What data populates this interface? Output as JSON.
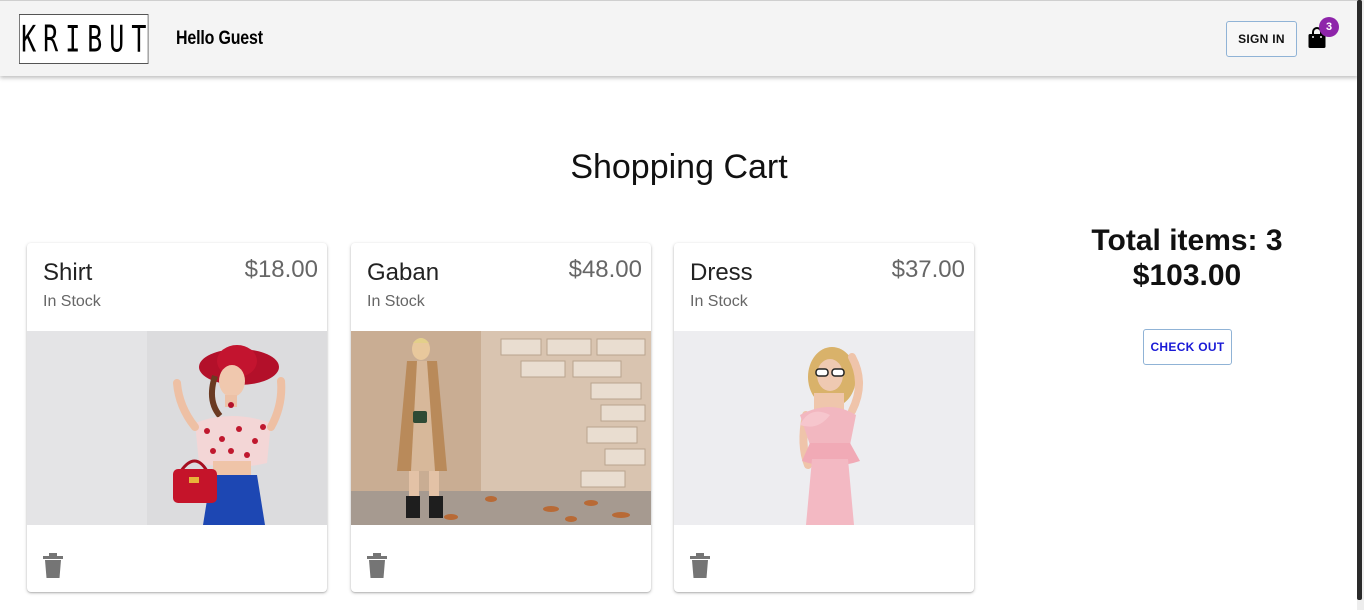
{
  "header": {
    "logo_text": "KRIBUT",
    "greeting": "Hello Guest",
    "sign_in_label": "SIGN IN",
    "cart_count": "3",
    "badge_color": "#8e24aa"
  },
  "main": {
    "title": "Shopping Cart",
    "items": [
      {
        "name": "Shirt",
        "price": "$18.00",
        "stock": "In Stock",
        "image": "woman in red hat and cropped floral top photo"
      },
      {
        "name": "Gaban",
        "price": "$48.00",
        "stock": "In Stock",
        "image": "woman in camel coat by brick wall photo"
      },
      {
        "name": "Dress",
        "price": "$37.00",
        "stock": "In Stock",
        "image": "woman in pink ruffled dress photo"
      }
    ]
  },
  "summary": {
    "total_items_text": "Total items: 3",
    "total_price": "$103.00",
    "checkout_label": "CHECK OUT"
  },
  "colors": {
    "accent_link": "#1a1ad6",
    "button_border": "#90b3d6"
  }
}
